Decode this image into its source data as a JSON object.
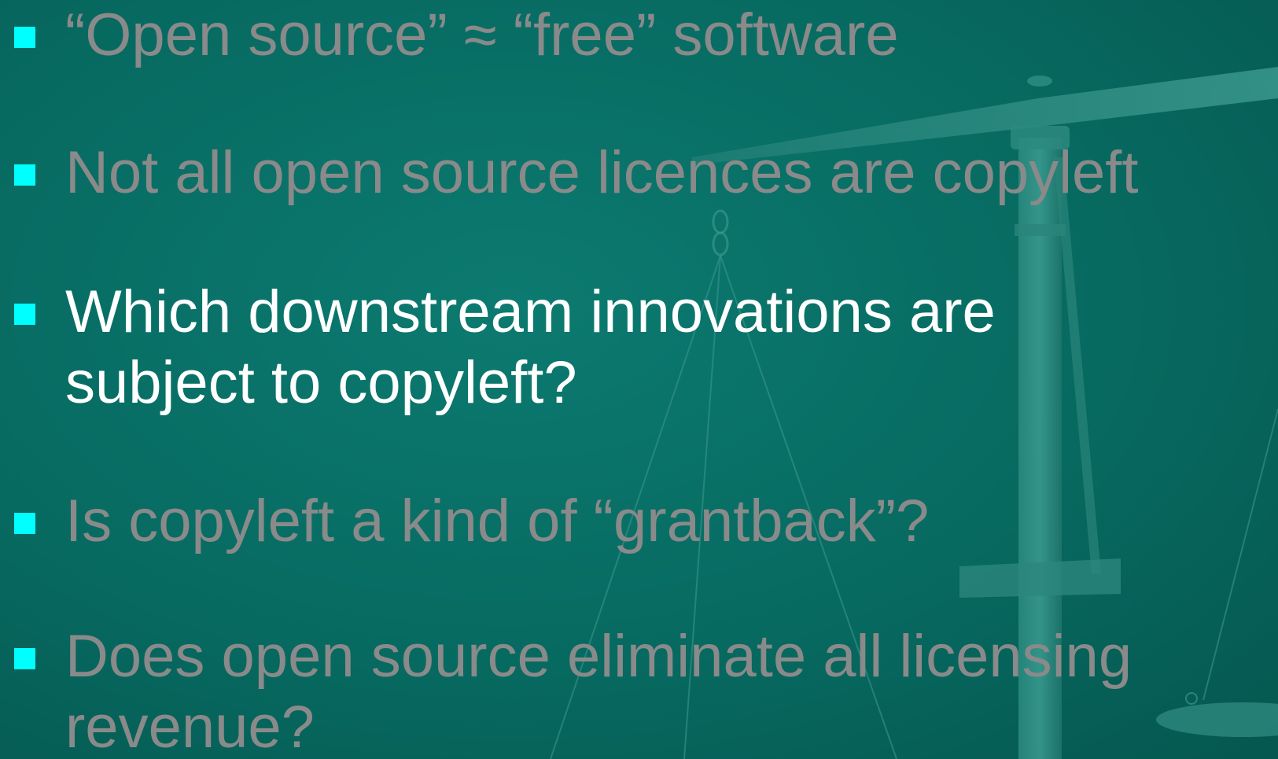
{
  "theme": {
    "background": "#087066",
    "bullet_color": "#00ffff",
    "dim_text_color": "#8a8a8a",
    "active_text_color": "#ffffff"
  },
  "decoration": {
    "background_image": "scales-of-justice"
  },
  "bullets": [
    {
      "lines": [
        "“Open source” ≈ “free” software"
      ],
      "state": "dim"
    },
    {
      "lines": [
        "Not all open source licences are copyleft"
      ],
      "state": "dim"
    },
    {
      "lines": [
        "Which downstream innovations are",
        "subject to copyleft?"
      ],
      "state": "active"
    },
    {
      "lines": [
        "Is copyleft a kind of “grantback”?"
      ],
      "state": "dim"
    },
    {
      "lines": [
        "Does open source eliminate all licensing",
        "revenue?"
      ],
      "state": "dim"
    }
  ]
}
